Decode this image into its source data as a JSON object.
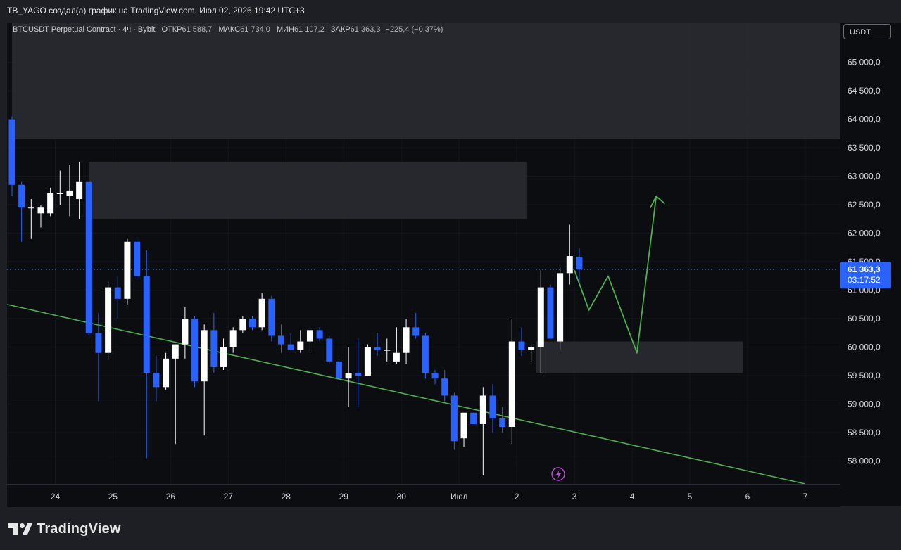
{
  "header": {
    "text": "TB_YAGO создал(а) график на TradingView.com, Июл 02, 2026 19:42 UTC+3"
  },
  "legend": {
    "symbol": "BTCUSDT Perpetual Contract · 4ч · Bybit",
    "open_label": "ОТКР",
    "open": "61 588,7",
    "high_label": "МАКС",
    "high": "61 734,0",
    "low_label": "МИН",
    "low": "61 107,2",
    "close_label": "ЗАКР",
    "close": "61 363,3",
    "change": "−225,4 (−0,37%)"
  },
  "price_axis": {
    "currency": "USDT"
  },
  "current_price": {
    "price": "61 363,3",
    "countdown": "03:17:52",
    "value": 61363.3
  },
  "brand": {
    "name": "TradingView"
  },
  "colors": {
    "bull": "#ffffff",
    "bear": "#2962ff",
    "trendline": "#4caf50",
    "zone": "#2a2b31",
    "background": "#0c0d11"
  },
  "chart_data": {
    "type": "candlestick",
    "timeframe": "4ч",
    "ylim": [
      57600,
      65700
    ],
    "y_ticks": [
      {
        "value": 58000,
        "label": "58 000,0"
      },
      {
        "value": 58500,
        "label": "58 500,0"
      },
      {
        "value": 59000,
        "label": "59 000,0"
      },
      {
        "value": 59500,
        "label": "59 500,0"
      },
      {
        "value": 60000,
        "label": "60 000,0"
      },
      {
        "value": 60500,
        "label": "60 500,0"
      },
      {
        "value": 61000,
        "label": "61 000,0"
      },
      {
        "value": 61500,
        "label": "61 500,0"
      },
      {
        "value": 62000,
        "label": "62 000,0"
      },
      {
        "value": 62500,
        "label": "62 500,0"
      },
      {
        "value": 63000,
        "label": "63 000,0"
      },
      {
        "value": 63500,
        "label": "63 500,0"
      },
      {
        "value": 64000,
        "label": "64 000,0"
      },
      {
        "value": 64500,
        "label": "64 500,0"
      },
      {
        "value": 65000,
        "label": "65 000,0"
      }
    ],
    "x_ticks": [
      {
        "index": 4.5,
        "label": "24"
      },
      {
        "index": 10.5,
        "label": "25"
      },
      {
        "index": 16.5,
        "label": "26"
      },
      {
        "index": 22.5,
        "label": "27"
      },
      {
        "index": 28.5,
        "label": "28"
      },
      {
        "index": 34.5,
        "label": "29"
      },
      {
        "index": 40.5,
        "label": "30"
      },
      {
        "index": 46.5,
        "label": "Июл"
      },
      {
        "index": 52.5,
        "label": "2"
      },
      {
        "index": 58.5,
        "label": "3"
      },
      {
        "index": 64.5,
        "label": "4"
      },
      {
        "index": 70.5,
        "label": "5"
      },
      {
        "index": 76.5,
        "label": "6"
      },
      {
        "index": 82.5,
        "label": "7"
      }
    ],
    "candles": [
      {
        "o": 64000,
        "h": 64050,
        "l": 62650,
        "c": 62850
      },
      {
        "o": 62850,
        "h": 62900,
        "l": 61850,
        "c": 62450
      },
      {
        "o": 62450,
        "h": 62600,
        "l": 61900,
        "c": 62450
      },
      {
        "o": 62350,
        "h": 62500,
        "l": 62100,
        "c": 62450
      },
      {
        "o": 62350,
        "h": 62800,
        "l": 62300,
        "c": 62700
      },
      {
        "o": 62700,
        "h": 63100,
        "l": 62500,
        "c": 62700
      },
      {
        "o": 62650,
        "h": 63200,
        "l": 62300,
        "c": 62750
      },
      {
        "o": 62600,
        "h": 63250,
        "l": 62250,
        "c": 62900
      },
      {
        "o": 62900,
        "h": 62900,
        "l": 60200,
        "c": 60250
      },
      {
        "o": 60250,
        "h": 60600,
        "l": 59050,
        "c": 59900
      },
      {
        "o": 59900,
        "h": 61150,
        "l": 59800,
        "c": 61050
      },
      {
        "o": 61050,
        "h": 61250,
        "l": 60500,
        "c": 60850
      },
      {
        "o": 60850,
        "h": 61900,
        "l": 60750,
        "c": 61850
      },
      {
        "o": 61850,
        "h": 61900,
        "l": 61200,
        "c": 61250
      },
      {
        "o": 61250,
        "h": 61700,
        "l": 58050,
        "c": 59550
      },
      {
        "o": 59550,
        "h": 59850,
        "l": 59050,
        "c": 59300
      },
      {
        "o": 59300,
        "h": 59900,
        "l": 59250,
        "c": 59800
      },
      {
        "o": 59800,
        "h": 60050,
        "l": 58300,
        "c": 60050
      },
      {
        "o": 60050,
        "h": 60700,
        "l": 59800,
        "c": 60500
      },
      {
        "o": 60500,
        "h": 60550,
        "l": 59300,
        "c": 59400
      },
      {
        "o": 59400,
        "h": 60400,
        "l": 58450,
        "c": 60300
      },
      {
        "o": 60300,
        "h": 60600,
        "l": 59550,
        "c": 59650
      },
      {
        "o": 59650,
        "h": 60150,
        "l": 59600,
        "c": 60000
      },
      {
        "o": 60000,
        "h": 60350,
        "l": 59900,
        "c": 60300
      },
      {
        "o": 60300,
        "h": 60550,
        "l": 60250,
        "c": 60500
      },
      {
        "o": 60500,
        "h": 60550,
        "l": 60300,
        "c": 60350
      },
      {
        "o": 60350,
        "h": 60950,
        "l": 60300,
        "c": 60850
      },
      {
        "o": 60850,
        "h": 60900,
        "l": 60100,
        "c": 60200
      },
      {
        "o": 60200,
        "h": 60400,
        "l": 59900,
        "c": 60050
      },
      {
        "o": 60050,
        "h": 60250,
        "l": 59950,
        "c": 59950
      },
      {
        "o": 59950,
        "h": 60300,
        "l": 59900,
        "c": 60100
      },
      {
        "o": 60100,
        "h": 60250,
        "l": 59900,
        "c": 60300
      },
      {
        "o": 60300,
        "h": 60350,
        "l": 60100,
        "c": 60150
      },
      {
        "o": 60150,
        "h": 60200,
        "l": 59700,
        "c": 59750
      },
      {
        "o": 59750,
        "h": 59850,
        "l": 59300,
        "c": 59450
      },
      {
        "o": 59450,
        "h": 60000,
        "l": 58950,
        "c": 59550
      },
      {
        "o": 59550,
        "h": 60150,
        "l": 58950,
        "c": 59500
      },
      {
        "o": 59500,
        "h": 60050,
        "l": 59500,
        "c": 60000
      },
      {
        "o": 60000,
        "h": 60250,
        "l": 59850,
        "c": 59950
      },
      {
        "o": 59950,
        "h": 60150,
        "l": 59750,
        "c": 59950
      },
      {
        "o": 59750,
        "h": 60350,
        "l": 59700,
        "c": 59900
      },
      {
        "o": 59900,
        "h": 60500,
        "l": 59700,
        "c": 60350
      },
      {
        "o": 60350,
        "h": 60600,
        "l": 60150,
        "c": 60200
      },
      {
        "o": 60200,
        "h": 60250,
        "l": 59450,
        "c": 59550
      },
      {
        "o": 59550,
        "h": 59600,
        "l": 59350,
        "c": 59450
      },
      {
        "o": 59450,
        "h": 59600,
        "l": 59050,
        "c": 59150
      },
      {
        "o": 59150,
        "h": 59200,
        "l": 58200,
        "c": 58350
      },
      {
        "o": 58400,
        "h": 58850,
        "l": 58250,
        "c": 58850
      },
      {
        "o": 58850,
        "h": 58850,
        "l": 58650,
        "c": 58650
      },
      {
        "o": 58650,
        "h": 59300,
        "l": 57750,
        "c": 59150
      },
      {
        "o": 59150,
        "h": 59350,
        "l": 58500,
        "c": 58750
      },
      {
        "o": 58750,
        "h": 58950,
        "l": 58500,
        "c": 58600
      },
      {
        "o": 58600,
        "h": 60500,
        "l": 58300,
        "c": 60100
      },
      {
        "o": 60100,
        "h": 60350,
        "l": 59850,
        "c": 59950
      },
      {
        "o": 59950,
        "h": 60050,
        "l": 59750,
        "c": 60000
      },
      {
        "o": 60000,
        "h": 61350,
        "l": 59550,
        "c": 61050
      },
      {
        "o": 61050,
        "h": 61100,
        "l": 60150,
        "c": 60150
      },
      {
        "o": 60100,
        "h": 61400,
        "l": 59950,
        "c": 61300
      },
      {
        "o": 61300,
        "h": 62150,
        "l": 61100,
        "c": 61600
      },
      {
        "o": 61588.7,
        "h": 61734.0,
        "l": 61107.2,
        "c": 61363.3
      }
    ],
    "zones": [
      {
        "x_from": 0,
        "x_to": 87,
        "price_low": 63650,
        "price_high": 65700
      },
      {
        "x_from": 8,
        "x_to": 53.5,
        "price_low": 62250,
        "price_high": 63250
      },
      {
        "x_from": 54.5,
        "x_to": 76,
        "price_low": 59550,
        "price_high": 60100
      }
    ],
    "trendline": {
      "from": {
        "x": -0.5,
        "price": 60750
      },
      "to": {
        "x": 82.5,
        "price": 57600
      }
    },
    "projection": [
      {
        "x": 58.5,
        "price": 61350
      },
      {
        "x": 60,
        "price": 60650
      },
      {
        "x": 62,
        "price": 61250
      },
      {
        "x": 65,
        "price": 59900
      },
      {
        "x": 67,
        "price": 62650
      },
      {
        "x": 66.4,
        "price": 62450
      },
      {
        "x": 67,
        "price": 62650
      },
      {
        "x": 67.9,
        "price": 62520
      }
    ]
  }
}
